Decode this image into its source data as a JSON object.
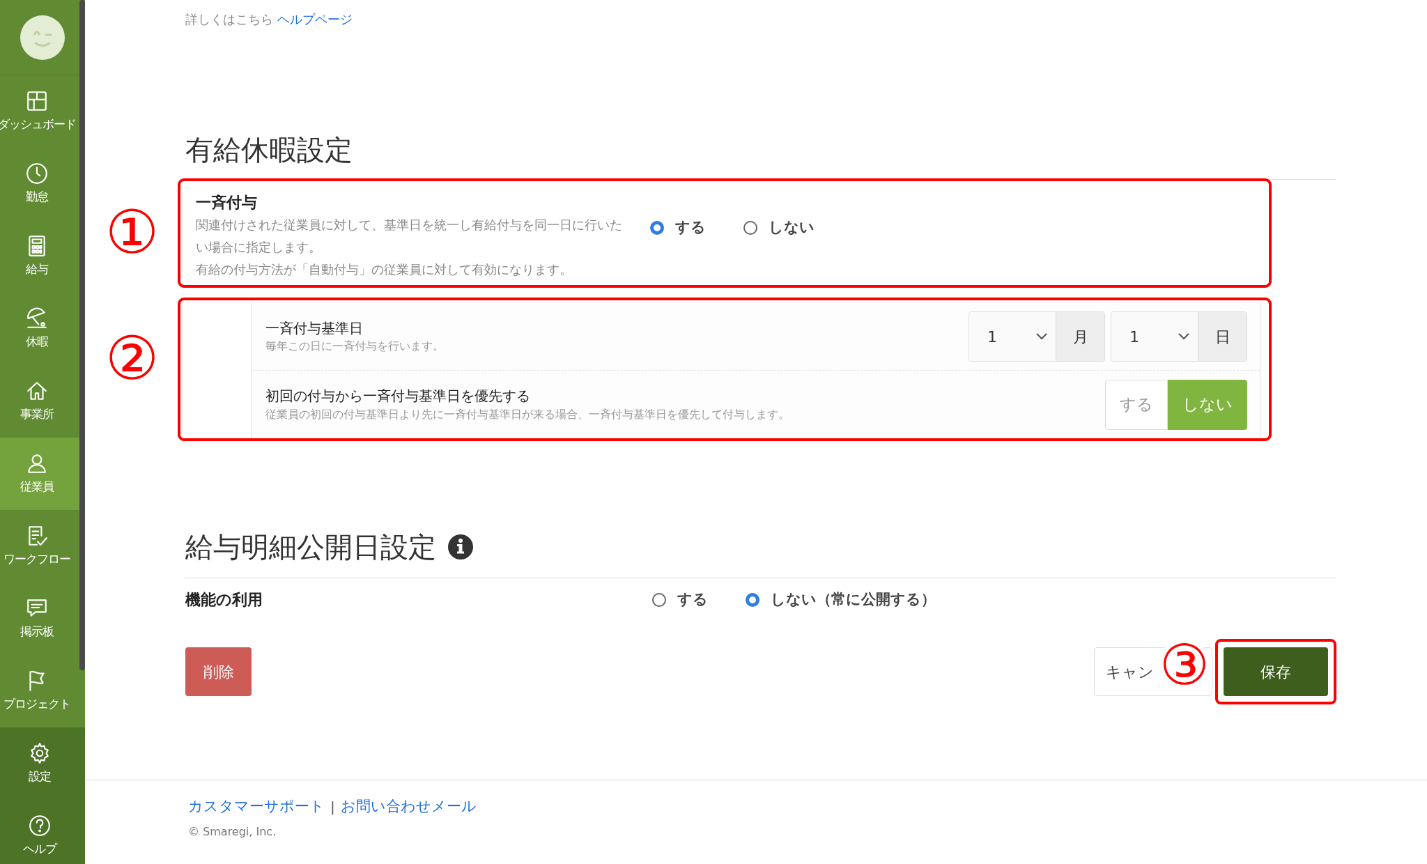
{
  "sidebar": {
    "items": [
      {
        "label": "ダッシュボード",
        "selected": false
      },
      {
        "label": "勤怠",
        "selected": false
      },
      {
        "label": "給与",
        "selected": false
      },
      {
        "label": "休暇",
        "selected": false
      },
      {
        "label": "事業所",
        "selected": false
      },
      {
        "label": "従業員",
        "selected": true
      },
      {
        "label": "ワークフロー",
        "selected": false
      },
      {
        "label": "掲示板",
        "selected": false
      },
      {
        "label": "プロジェクト",
        "selected": false
      }
    ],
    "bottom_items": [
      {
        "label": "設定",
        "selected": false
      },
      {
        "label": "ヘルプ",
        "selected": false
      }
    ]
  },
  "intro": {
    "text": "詳しくはこちら",
    "link": "ヘルプページ"
  },
  "paid_leave": {
    "title": "有給休暇設定",
    "bulk_grant": {
      "annotation": "①",
      "label": "一斉付与",
      "description": [
        "関連付けされた従業員に対して、基準日を統一し有給付与を同一日に行いたい場合に指定します。",
        "有給の付与方法が「自動付与」の従業員に対して有効になります。"
      ],
      "options": [
        {
          "label": "する",
          "selected": true
        },
        {
          "label": "しない",
          "selected": false
        }
      ]
    },
    "details_annotation": "②",
    "details": [
      {
        "kind": "date",
        "label": "一斉付与基準日",
        "description": "毎年この日に一斉付与を行います。",
        "selects": [
          {
            "value": "1",
            "unit": "月"
          },
          {
            "value": "1",
            "unit": "日"
          }
        ]
      },
      {
        "kind": "toggle",
        "label": "初回の付与から一斉付与基準日を優先する",
        "description": "従業員の初回の付与基準日より先に一斉付与基準日が来る場合、一斉付与基準日を優先して付与します。",
        "options": [
          {
            "label": "する",
            "selected": false
          },
          {
            "label": "しない",
            "selected": true
          }
        ]
      }
    ]
  },
  "payslip": {
    "title": "給与明細公開日設定",
    "label": "機能の利用",
    "options": [
      {
        "label": "する",
        "selected": false
      },
      {
        "label": "しない（常に公開する）",
        "selected": true
      }
    ]
  },
  "actions": {
    "delete": "削除",
    "cancel": "キャン",
    "save": "保存",
    "save_annotation": "③"
  },
  "footer": {
    "links": [
      "カスタマーサポート",
      "お問い合わせメール"
    ],
    "separator": "|",
    "copyright": "© Smaregi, Inc."
  }
}
